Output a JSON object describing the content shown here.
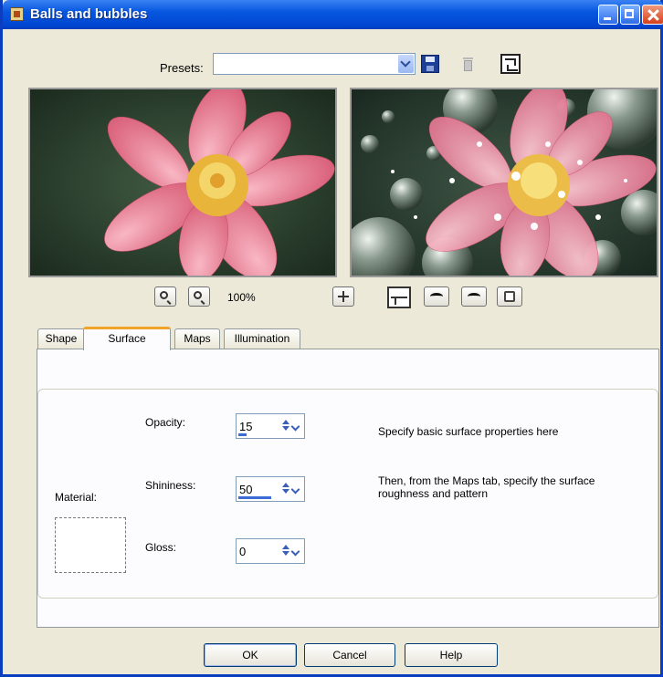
{
  "window": {
    "title": "Balls and bubbles"
  },
  "presets": {
    "label": "Presets:",
    "value": ""
  },
  "zoom": {
    "level": "100%"
  },
  "tabs": [
    {
      "label": "Shape"
    },
    {
      "label": "Surface"
    },
    {
      "label": "Maps"
    },
    {
      "label": "Illumination"
    }
  ],
  "active_tab": "Surface",
  "surface": {
    "material_label": "Material:",
    "opacity": {
      "label": "Opacity:",
      "value": "15",
      "fraction": 0.15
    },
    "shininess": {
      "label": "Shininess:",
      "value": "50",
      "fraction": 0.5
    },
    "gloss": {
      "label": "Gloss:",
      "value": "0",
      "fraction": 0
    },
    "help1": "Specify basic surface properties here",
    "help2": "Then, from the Maps tab, specify the surface roughness and pattern"
  },
  "buttons": {
    "ok": "OK",
    "cancel": "Cancel",
    "help": "Help"
  },
  "colors": {
    "titlebar": "#0757e0",
    "dialog": "#ece9d8",
    "accent_tab": "#f2a42a"
  }
}
